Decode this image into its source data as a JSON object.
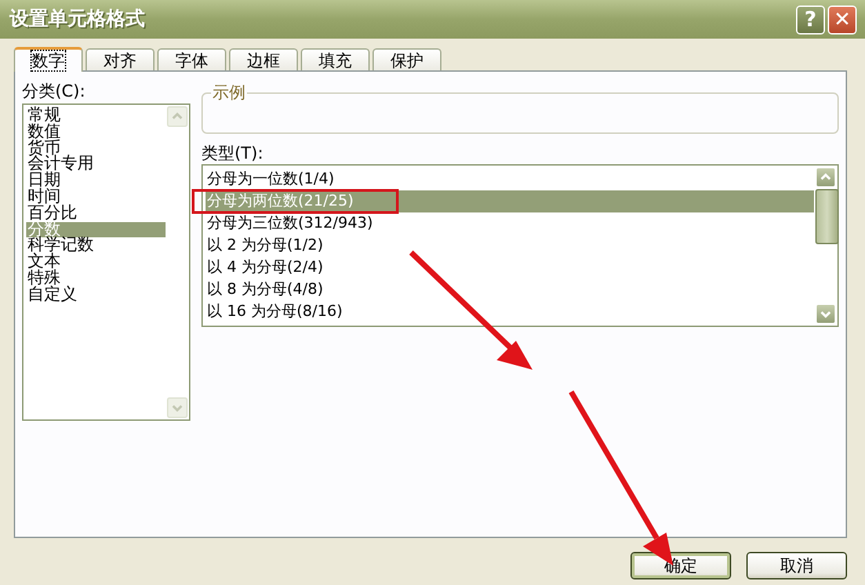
{
  "window": {
    "title": "设置单元格格式",
    "help_button": "?",
    "close_button": "✕"
  },
  "tabs": [
    {
      "label": "数字",
      "selected": true
    },
    {
      "label": "对齐",
      "selected": false
    },
    {
      "label": "字体",
      "selected": false
    },
    {
      "label": "边框",
      "selected": false
    },
    {
      "label": "填充",
      "selected": false
    },
    {
      "label": "保护",
      "selected": false
    }
  ],
  "category": {
    "label": "分类(C):",
    "items": [
      {
        "label": "常规",
        "selected": false
      },
      {
        "label": "数值",
        "selected": false
      },
      {
        "label": "货币",
        "selected": false
      },
      {
        "label": "会计专用",
        "selected": false
      },
      {
        "label": "日期",
        "selected": false
      },
      {
        "label": "时间",
        "selected": false
      },
      {
        "label": "百分比",
        "selected": false
      },
      {
        "label": "分数",
        "selected": true
      },
      {
        "label": "科学记数",
        "selected": false
      },
      {
        "label": "文本",
        "selected": false
      },
      {
        "label": "特殊",
        "selected": false
      },
      {
        "label": "自定义",
        "selected": false
      }
    ]
  },
  "sample": {
    "label": "示例"
  },
  "type": {
    "label": "类型(T):",
    "items": [
      {
        "label": "分母为一位数(1/4)",
        "selected": false
      },
      {
        "label": "分母为两位数(21/25)",
        "selected": true
      },
      {
        "label": "分母为三位数(312/943)",
        "selected": false
      },
      {
        "label": "以 2 为分母(1/2)",
        "selected": false
      },
      {
        "label": "以 4 为分母(2/4)",
        "selected": false
      },
      {
        "label": "以 8 为分母(4/8)",
        "selected": false
      },
      {
        "label": "以 16 为分母(8/16)",
        "selected": false
      }
    ]
  },
  "buttons": [
    {
      "label": "确定",
      "kind": "default"
    },
    {
      "label": "取消",
      "kind": "normal"
    }
  ]
}
